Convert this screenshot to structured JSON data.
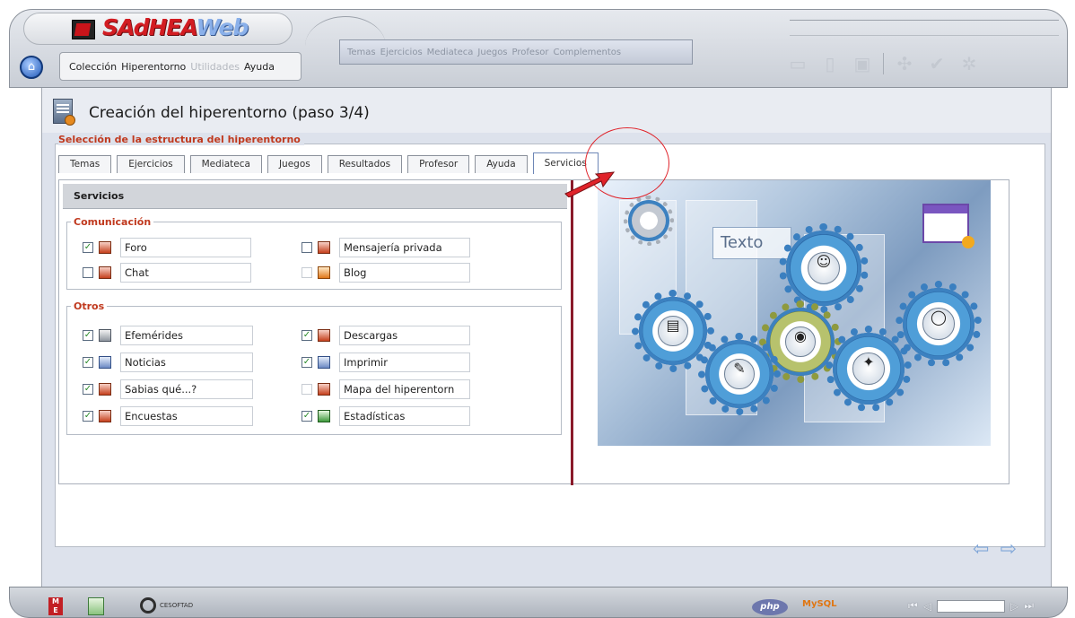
{
  "app": {
    "logo_main": "SAdHEA",
    "logo_accent": "Web"
  },
  "menu_left": {
    "items": [
      {
        "label": "Colección",
        "enabled": true
      },
      {
        "label": "Hiperentorno",
        "enabled": true
      },
      {
        "label": "Utilidades",
        "enabled": false
      },
      {
        "label": "Ayuda",
        "enabled": true
      }
    ]
  },
  "menu_center": {
    "items": [
      "Temas",
      "Ejercicios",
      "Mediateca",
      "Juegos",
      "Profesor",
      "Complementos"
    ]
  },
  "toolbar": {
    "icons": [
      "new-icon",
      "open-icon",
      "save-icon",
      "settings-icon",
      "check-icon",
      "config-icon"
    ]
  },
  "page": {
    "title": "Creación del hiperentorno (paso 3/4)",
    "section_title": "Selección de la estructura del hiperentorno"
  },
  "tabs": [
    {
      "label": "Temas",
      "active": false
    },
    {
      "label": "Ejercicios",
      "active": false
    },
    {
      "label": "Mediateca",
      "active": false
    },
    {
      "label": "Juegos",
      "active": false
    },
    {
      "label": "Resultados",
      "active": false
    },
    {
      "label": "Profesor",
      "active": false
    },
    {
      "label": "Ayuda",
      "active": false
    },
    {
      "label": "Servicios",
      "active": true
    }
  ],
  "services": {
    "heading": "Servicios",
    "comunicacion": {
      "legend": "Comunicación",
      "items": [
        {
          "label": "Foro",
          "checked": true,
          "enabled": true
        },
        {
          "label": "Mensajería privada",
          "checked": false,
          "enabled": true
        },
        {
          "label": "Chat",
          "checked": false,
          "enabled": true
        },
        {
          "label": "Blog",
          "checked": false,
          "enabled": false
        }
      ]
    },
    "otros": {
      "legend": "Otros",
      "items": [
        {
          "label": "Efemérides",
          "checked": true,
          "enabled": true
        },
        {
          "label": "Descargas",
          "checked": true,
          "enabled": true
        },
        {
          "label": "Noticias",
          "checked": true,
          "enabled": true
        },
        {
          "label": "Imprimir",
          "checked": true,
          "enabled": true
        },
        {
          "label": "Sabias qué...?",
          "checked": true,
          "enabled": true
        },
        {
          "label": "Mapa del hiperentorn",
          "checked": false,
          "enabled": false
        },
        {
          "label": "Encuestas",
          "checked": true,
          "enabled": true
        },
        {
          "label": "Estadísticas",
          "checked": true,
          "enabled": true
        }
      ]
    }
  },
  "illustration": {
    "text": "Texto"
  },
  "footer": {
    "me_logo": "M E",
    "ceso_label": "CESOFTAD",
    "php_label": "php",
    "mysql_label": "MySQL"
  },
  "colors": {
    "accent_red": "#c0391e",
    "divider": "#8a1a2a",
    "check_green": "#2a8a2a",
    "annotation_red": "#e0232a"
  }
}
